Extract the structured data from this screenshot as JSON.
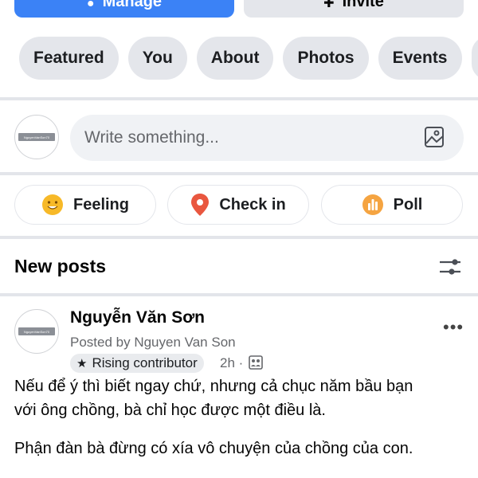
{
  "header": {
    "manage_label": "Manage",
    "invite_label": "Invite"
  },
  "tabs": [
    {
      "label": "Featured"
    },
    {
      "label": "You"
    },
    {
      "label": "About"
    },
    {
      "label": "Photos"
    },
    {
      "label": "Events"
    }
  ],
  "composer": {
    "avatar_text": "NguyenVanSon70",
    "placeholder": "Write something..."
  },
  "actions": [
    {
      "label": "Feeling",
      "icon": "emoji-icon",
      "color": "#f7b928"
    },
    {
      "label": "Check in",
      "icon": "location-pin-icon",
      "color": "#e9573f"
    },
    {
      "label": "Poll",
      "icon": "poll-icon",
      "color": "#f5a441"
    }
  ],
  "feed": {
    "title": "New posts",
    "post": {
      "author": "Nguyễn Văn Sơn",
      "posted_by": "Posted by Nguyen Van Son",
      "badge": "Rising contributor",
      "time": "2h",
      "text_line1": "Nếu để ý thì biết ngay chứ, nhưng cả chục năm bầu bạn",
      "text_line2": "với ông chồng, bà chỉ học được một điều là.",
      "text_line3": "Phận đàn bà đừng có xía vô chuyện của chồng của con."
    }
  },
  "colors": {
    "primary": "#3b82f6",
    "chip_bg": "#e4e6eb",
    "muted_text": "#65676b"
  }
}
